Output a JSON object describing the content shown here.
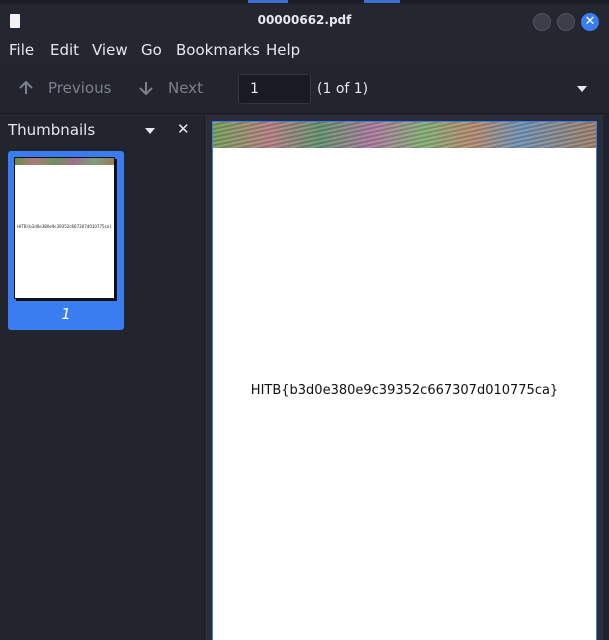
{
  "window": {
    "title": "00000662.pdf"
  },
  "menu": [
    "File",
    "Edit",
    "View",
    "Go",
    "Bookmarks",
    "Help"
  ],
  "toolbar": {
    "previous_label": "Previous",
    "next_label": "Next",
    "page_value": "1",
    "page_count": "(1 of 1)"
  },
  "sidebar": {
    "header": "Thumbnails",
    "thumbnail": {
      "page_number": "1",
      "text": "HITB{b3d0e380e9c39352c667307d010775ca}"
    }
  },
  "document": {
    "text": "HITB{b3d0e380e9c39352c667307d010775ca}"
  },
  "colors": {
    "accent": "#3a7df0",
    "background": "#23252e"
  },
  "icons": [
    "app-icon",
    "minimize-icon",
    "maximize-icon",
    "close-icon",
    "arrow-up-icon",
    "arrow-down-icon",
    "chevron-down-icon",
    "close-x-icon"
  ]
}
